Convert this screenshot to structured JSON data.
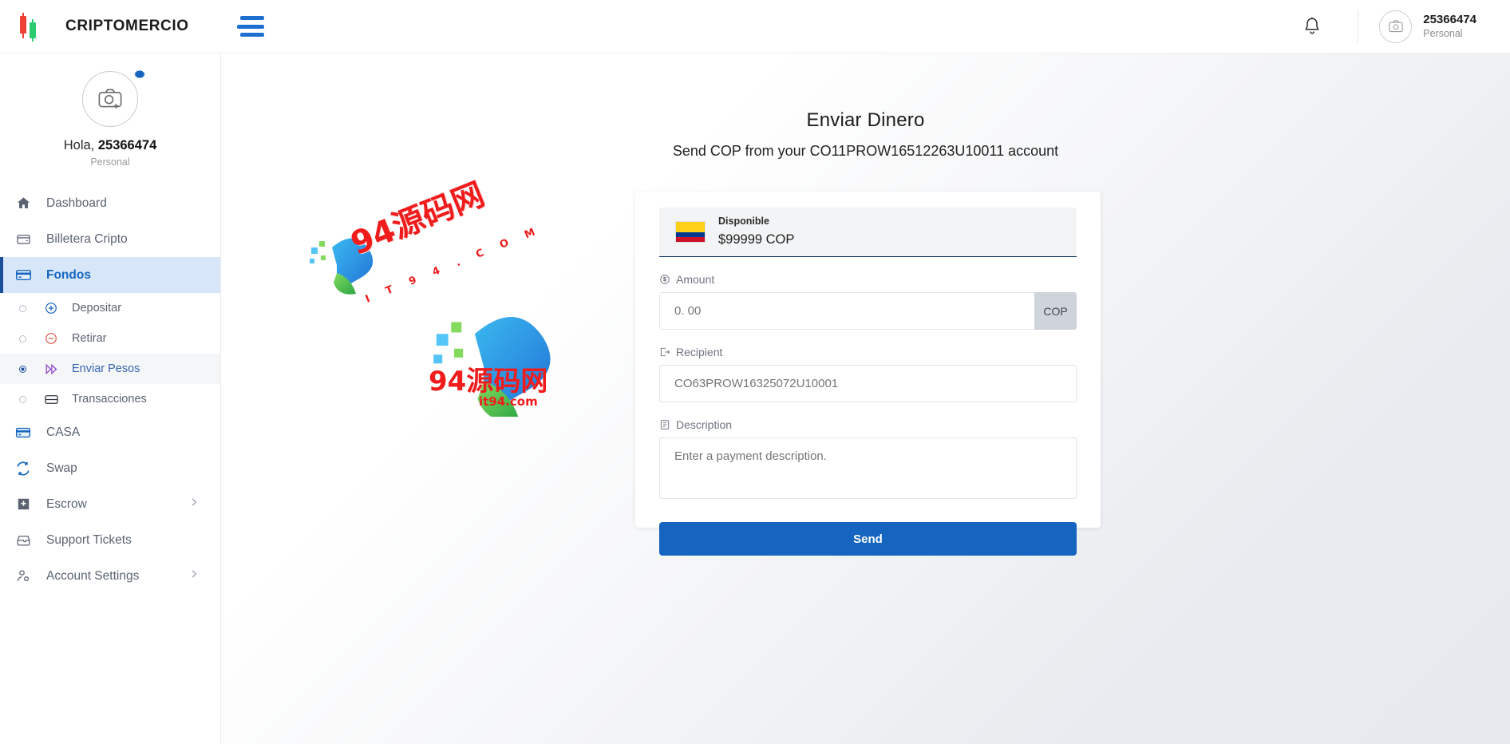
{
  "topbar": {
    "brand": "CRIPTOMERCIO",
    "logo_icon": "candlestick-logo-icon",
    "menu_toggle_icon": "hamburger-icon",
    "notifications_icon": "bell-icon",
    "avatar_icon": "camera-avatar-icon",
    "user_name": "25366474",
    "user_type": "Personal"
  },
  "sidebar": {
    "profile": {
      "avatar_icon": "camera-add-icon",
      "settings_badge_icon": "gear-icon",
      "greeting_prefix": "Hola, ",
      "greeting_name": "25366474",
      "account_type": "Personal"
    },
    "items": [
      {
        "label": "Dashboard",
        "icon": "home-icon",
        "active": false,
        "has_chevron": false
      },
      {
        "label": "Billetera Cripto",
        "icon": "wallet-icon",
        "active": false,
        "has_chevron": false
      },
      {
        "label": "Fondos",
        "icon": "credit-card-icon",
        "active": true,
        "has_chevron": false
      }
    ],
    "subitems": [
      {
        "label": "Depositar",
        "icon": "plus-circle-icon",
        "active": false
      },
      {
        "label": "Retirar",
        "icon": "minus-circle-icon",
        "active": false
      },
      {
        "label": "Enviar Pesos",
        "icon": "fast-forward-icon",
        "active": true
      },
      {
        "label": "Transacciones",
        "icon": "transactions-card-icon",
        "active": false
      }
    ],
    "items_bottom": [
      {
        "label": "CASA",
        "icon": "bank-card-icon",
        "active": false,
        "has_chevron": false
      },
      {
        "label": "Swap",
        "icon": "swap-arrows-icon",
        "active": false,
        "has_chevron": false
      },
      {
        "label": "Escrow",
        "icon": "shield-plus-icon",
        "active": false,
        "has_chevron": true
      },
      {
        "label": "Support Tickets",
        "icon": "inbox-icon",
        "active": false,
        "has_chevron": false
      },
      {
        "label": "Account Settings",
        "icon": "user-settings-icon",
        "active": false,
        "has_chevron": true
      }
    ],
    "chevron_icon": "chevron-right-icon"
  },
  "main": {
    "title": "Enviar Dinero",
    "subtitle": "Send COP from your CO11PROW16512263U10011 account",
    "balance": {
      "flag_icon": "colombia-flag-icon",
      "label": "Disponible",
      "amount": "$99999 COP"
    },
    "amount_field": {
      "icon": "coin-icon",
      "label": "Amount",
      "placeholder": "0. 00",
      "value": "",
      "suffix": "COP"
    },
    "recipient_field": {
      "icon": "send-out-icon",
      "label": "Recipient",
      "placeholder": "CO63PROW16325072U10001",
      "value": ""
    },
    "description_field": {
      "icon": "document-icon",
      "label": "Description",
      "placeholder": "Enter a payment description.",
      "value": ""
    },
    "submit_label": "Send"
  },
  "watermark": {
    "cn_top": "94源码网",
    "it94_spaced": "I T 9 4 . C O M",
    "cn_bottom": "94源码网",
    "site": "it94.com"
  },
  "colors": {
    "accent_blue": "#1565c0",
    "active_bg": "#d7e7f9",
    "active_border": "#1b4f9c",
    "logo_red": "#ef4036",
    "logo_green": "#2ecc71",
    "watermark_red": "#f01c1c",
    "flag_yellow": "#fcd116",
    "flag_blue": "#003893",
    "flag_red": "#ce1126"
  }
}
